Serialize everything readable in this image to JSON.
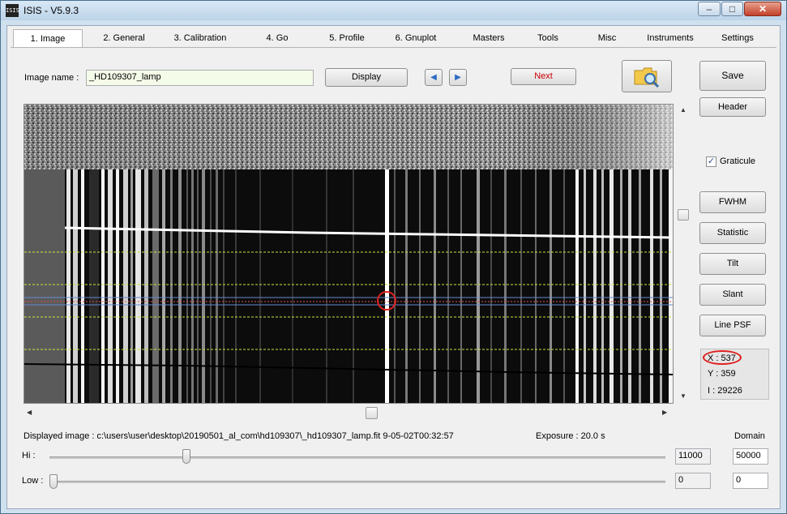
{
  "window": {
    "title": "ISIS - V5.9.3",
    "icon_text": "ISIS",
    "minimize": "–",
    "maximize": "□",
    "close": "✕"
  },
  "tabs": [
    {
      "label": "1. Image"
    },
    {
      "label": "2. General"
    },
    {
      "label": "3. Calibration"
    },
    {
      "label": "4. Go"
    },
    {
      "label": "5. Profile"
    },
    {
      "label": "6. Gnuplot"
    },
    {
      "label": "Masters"
    },
    {
      "label": "Tools"
    },
    {
      "label": "Misc"
    },
    {
      "label": "Instruments"
    },
    {
      "label": "Settings"
    }
  ],
  "image_name": {
    "label": "Image name :",
    "value": "_HD109307_lamp"
  },
  "buttons": {
    "display": "Display",
    "next": "Next",
    "save": "Save",
    "header": "Header",
    "fwhm": "FWHM",
    "statistic": "Statistic",
    "tilt": "Tilt",
    "slant": "Slant",
    "line_psf": "Line PSF",
    "prev_arrow": "◀",
    "next_arrow": "▶"
  },
  "graticule": {
    "label": "Graticule",
    "checked": true,
    "check": "✓"
  },
  "cursor": {
    "x": "X : 537",
    "y": "Y : 359",
    "i": "I  : 29226"
  },
  "status": {
    "displayed_image": "Displayed image : c:\\users\\user\\desktop\\20190501_al_com\\hd109307\\_hd109307_lamp.fit  9-05-02T00:32:57",
    "exposure": "Exposure : 20.0 s",
    "domain_label": "Domain"
  },
  "hi": {
    "label": "Hi :",
    "value": "11000",
    "domain": "50000"
  },
  "low": {
    "label": "Low :",
    "value": "0",
    "domain": "0"
  },
  "colors": {
    "graticule": "#c8e63a",
    "marker": "#e02020",
    "next_text": "#cc0000"
  }
}
